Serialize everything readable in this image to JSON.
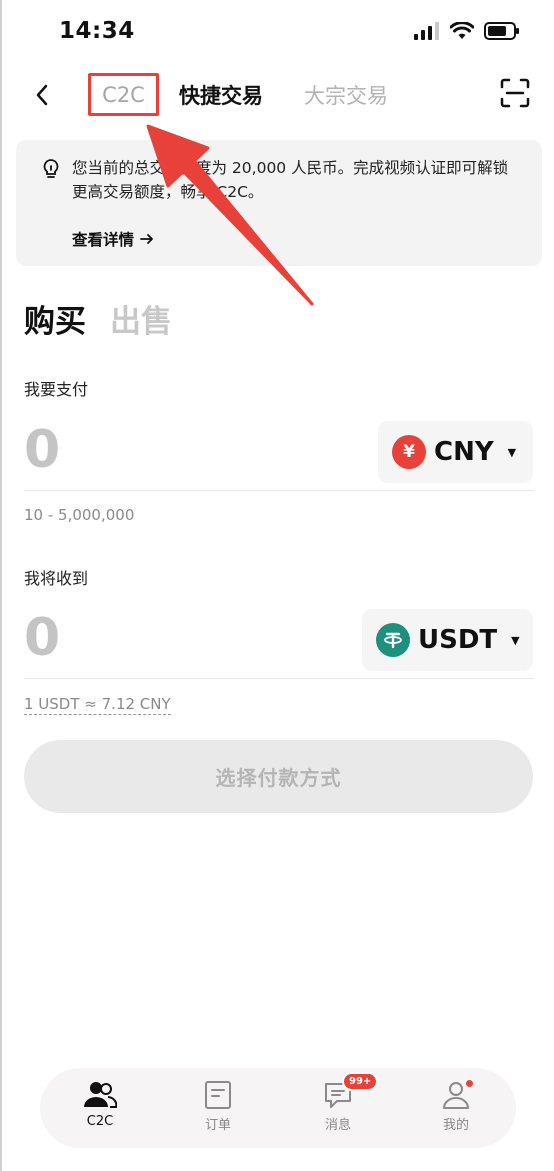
{
  "status": {
    "time": "14:34"
  },
  "nav": {
    "tabs": [
      "C2C",
      "快捷交易",
      "大宗交易"
    ]
  },
  "notice": {
    "text": "您当前的总交易额度为 20,000 人民币。完成视频认证即可解锁更高交易额度，畅享 C2C。",
    "link": "查看详情"
  },
  "trade": {
    "tabs": [
      "购买",
      "出售"
    ],
    "pay": {
      "label": "我要支付",
      "amount": "0",
      "currency": "CNY",
      "currency_symbol": "¥",
      "range": "10 - 5,000,000"
    },
    "receive": {
      "label": "我将收到",
      "amount": "0",
      "currency": "USDT",
      "rate": "1 USDT ≈ 7.12 CNY"
    },
    "cta": "选择付款方式"
  },
  "tabbar": {
    "items": [
      {
        "label": "C2C",
        "icon": "users-icon",
        "active": true
      },
      {
        "label": "订单",
        "icon": "document-icon",
        "active": false
      },
      {
        "label": "消息",
        "icon": "message-icon",
        "active": false,
        "badge": "99+"
      },
      {
        "label": "我的",
        "icon": "profile-icon",
        "active": false
      }
    ]
  },
  "colors": {
    "accent_red": "#e8413a",
    "tether_green": "#1f8f7e",
    "cny_red": "#e8413a"
  }
}
